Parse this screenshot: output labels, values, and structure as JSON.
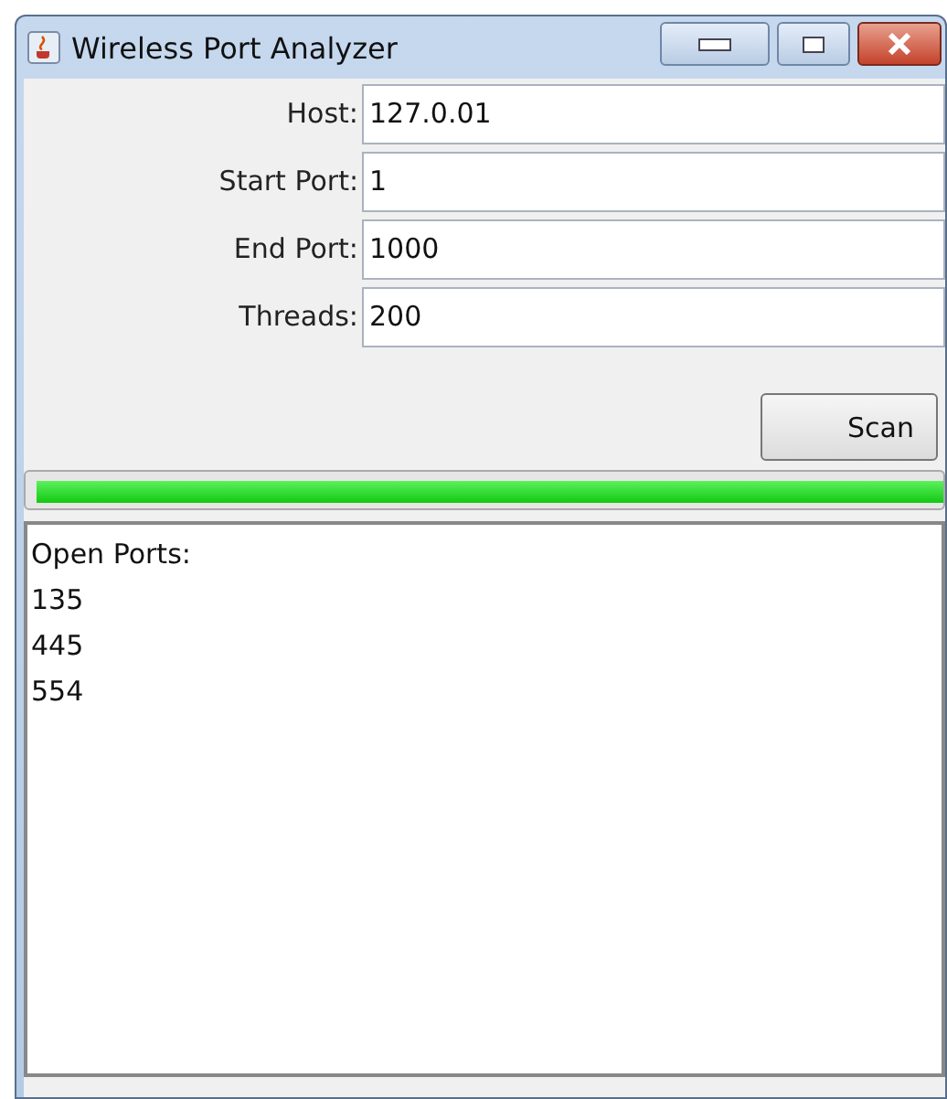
{
  "window": {
    "title": "Wireless Port Analyzer"
  },
  "fields": [
    {
      "label": "Host:",
      "value": "127.0.01"
    },
    {
      "label": "Start Port:",
      "value": "1"
    },
    {
      "label": "End Port:",
      "value": "1000"
    },
    {
      "label": "Threads:",
      "value": "200"
    }
  ],
  "scan_button": "Scan",
  "progress": {
    "level": 1.0
  },
  "output": [
    "Open Ports:",
    "135",
    "445",
    "554"
  ]
}
